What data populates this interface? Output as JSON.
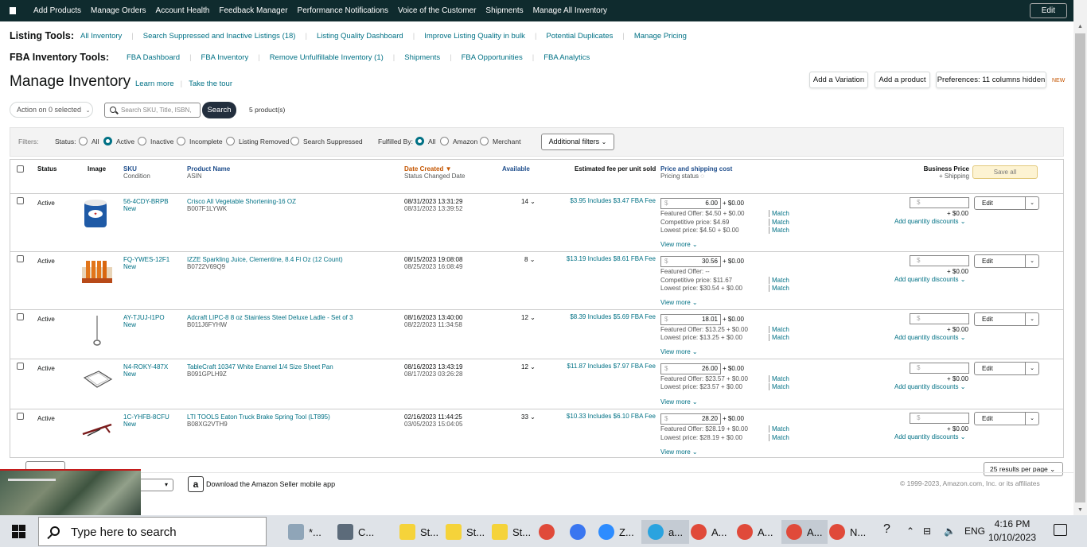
{
  "topnav": {
    "items": [
      "Add Products",
      "Manage Orders",
      "Account Health",
      "Feedback Manager",
      "Performance Notifications",
      "Voice of the Customer",
      "Shipments",
      "Manage All Inventory"
    ],
    "edit_label": "Edit"
  },
  "listing_tools": {
    "title": "Listing Tools:",
    "links": [
      "All Inventory",
      "Search Suppressed and Inactive Listings (18)",
      "Listing Quality Dashboard",
      "Improve Listing Quality in bulk",
      "Potential Duplicates",
      "Manage Pricing"
    ]
  },
  "fba_tools": {
    "title": "FBA Inventory Tools:",
    "links": [
      "FBA Dashboard",
      "FBA Inventory",
      "Remove Unfulfillable Inventory (1)",
      "Shipments",
      "FBA Opportunities",
      "FBA Analytics"
    ]
  },
  "page": {
    "title": "Manage Inventory",
    "learn_more": "Learn more",
    "take_tour": "Take the tour",
    "add_variation": "Add a Variation",
    "add_product": "Add a product",
    "preferences": "Preferences: 11 columns hidden",
    "new_badge": "NEW"
  },
  "toolbar": {
    "action_label": "Action on 0 selected",
    "search_placeholder": "Search SKU, Title, ISBN,",
    "search_button": "Search",
    "product_count": "5 product(s)"
  },
  "filters": {
    "label": "Filters:",
    "status_label": "Status:",
    "status_options": [
      "All",
      "Active",
      "Inactive",
      "Incomplete",
      "Listing Removed",
      "Search Suppressed"
    ],
    "status_selected": "Active",
    "fulfilled_label": "Fulfilled By:",
    "fulfilled_options": [
      "All",
      "Amazon",
      "Merchant"
    ],
    "fulfilled_selected": "All",
    "additional": "Additional filters"
  },
  "table": {
    "headers": {
      "status": "Status",
      "image": "Image",
      "sku": "SKU",
      "sku_sub": "Condition",
      "product_name": "Product Name",
      "product_sub": "ASIN",
      "date_created": "Date Created",
      "date_sub": "Status Changed Date",
      "available": "Available",
      "fee": "Estimated fee per unit sold",
      "price": "Price and shipping cost",
      "price_sub": "Pricing status",
      "business": "Business Price",
      "business_sub": "+ Shipping",
      "save_all": "Save all"
    },
    "rows": [
      {
        "status": "Active",
        "sku": "56-4CDY-BRPB",
        "condition": "New",
        "name": "Crisco All Vegetable Shortening-16 OZ",
        "asin": "B007F1LYWK",
        "date_created": "08/31/2023 13:31:29",
        "date_changed": "08/31/2023 13:39:52",
        "available": "14",
        "fee": "$3.95 Includes $3.47 FBA Fee",
        "price": "6.00",
        "shipping": "+ $0.00",
        "offers": [
          {
            "text": "Featured Offer: $4.50 + $0.00",
            "match": "Match"
          },
          {
            "text": "Competitive price: $4.69",
            "match": "Match"
          },
          {
            "text": "Lowest price: $4.50 + $0.00",
            "match": "Match"
          }
        ],
        "view_more": "View more",
        "biz_ship": "+ $0.00",
        "qty_discounts": "Add quantity discounts",
        "edit": "Edit"
      },
      {
        "status": "Active",
        "sku": "FQ-YWES-12F1",
        "condition": "New",
        "name": "IZZE Sparkling Juice, Clementine, 8.4 Fl Oz (12 Count)",
        "asin": "B0722V69Q9",
        "date_created": "08/15/2023 19:08:08",
        "date_changed": "08/25/2023 16:08:49",
        "available": "8",
        "fee": "$13.19 Includes $8.61 FBA Fee",
        "price": "30.56",
        "shipping": "+ $0.00",
        "offers": [
          {
            "text": "Featured Offer: --",
            "match": ""
          },
          {
            "text": "Competitive price: $11.67",
            "match": "Match"
          },
          {
            "text": "Lowest price: $30.54 + $0.00",
            "match": "Match"
          }
        ],
        "view_more": "View more",
        "biz_ship": "+ $0.00",
        "qty_discounts": "Add quantity discounts",
        "edit": "Edit"
      },
      {
        "status": "Active",
        "sku": "AY-TJUJ-I1PO",
        "condition": "New",
        "name": "Adcraft LIPC-8 8 oz Stainless Steel Deluxe Ladle - Set of 3",
        "asin": "B011J6FYHW",
        "date_created": "08/16/2023 13:40:00",
        "date_changed": "08/22/2023 11:34:58",
        "available": "12",
        "fee": "$8.39 Includes $5.69 FBA Fee",
        "price": "18.01",
        "shipping": "+ $0.00",
        "offers": [
          {
            "text": "Featured Offer: $13.25 + $0.00",
            "match": "Match"
          },
          {
            "text": "Lowest price: $13.25 + $0.00",
            "match": "Match"
          }
        ],
        "view_more": "View more",
        "biz_ship": "+ $0.00",
        "qty_discounts": "Add quantity discounts",
        "edit": "Edit"
      },
      {
        "status": "Active",
        "sku": "N4-ROKY-487X",
        "condition": "New",
        "name": "TableCraft 10347 White Enamel 1/4 Size Sheet Pan",
        "asin": "B091GPLH9Z",
        "date_created": "08/16/2023 13:43:19",
        "date_changed": "08/17/2023 03:26:28",
        "available": "12",
        "fee": "$11.87 Includes $7.97 FBA Fee",
        "price": "26.00",
        "shipping": "+ $0.00",
        "offers": [
          {
            "text": "Featured Offer: $23.57 + $0.00",
            "match": "Match"
          },
          {
            "text": "Lowest price: $23.57 + $0.00",
            "match": "Match"
          }
        ],
        "view_more": "View more",
        "biz_ship": "+ $0.00",
        "qty_discounts": "Add quantity discounts",
        "edit": "Edit"
      },
      {
        "status": "Active",
        "sku": "1C-YHFB-8CFU",
        "condition": "New",
        "name": "LTI TOOLS Eaton Truck Brake Spring Tool (LT895)",
        "asin": "B08XG2VTH9",
        "date_created": "02/16/2023 11:44:25",
        "date_changed": "03/05/2023 15:04:05",
        "available": "33",
        "fee": "$10.33 Includes $6.10 FBA Fee",
        "price": "28.20",
        "shipping": "+ $0.00",
        "offers": [
          {
            "text": "Featured Offer: $28.19 + $0.00",
            "match": "Match"
          },
          {
            "text": "Lowest price: $28.19 + $0.00",
            "match": "Match"
          }
        ],
        "view_more": "View more",
        "biz_ship": "+ $0.00",
        "qty_discounts": "Add quantity discounts",
        "edit": "Edit"
      }
    ]
  },
  "footer": {
    "results_per_page": "25 results per page",
    "app_text": "Download the Amazon Seller mobile app",
    "copyright": "© 1999-2023, Amazon.com, Inc. or its affiliates"
  },
  "taskbar": {
    "search_placeholder": "Type here to search",
    "items": [
      "*...",
      "C...",
      "St...",
      "St...",
      "St...",
      "Z...",
      "a...",
      "A...",
      "A...",
      "A...",
      "N..."
    ],
    "lang": "ENG",
    "time": "4:16 PM",
    "date": "10/10/2023"
  }
}
